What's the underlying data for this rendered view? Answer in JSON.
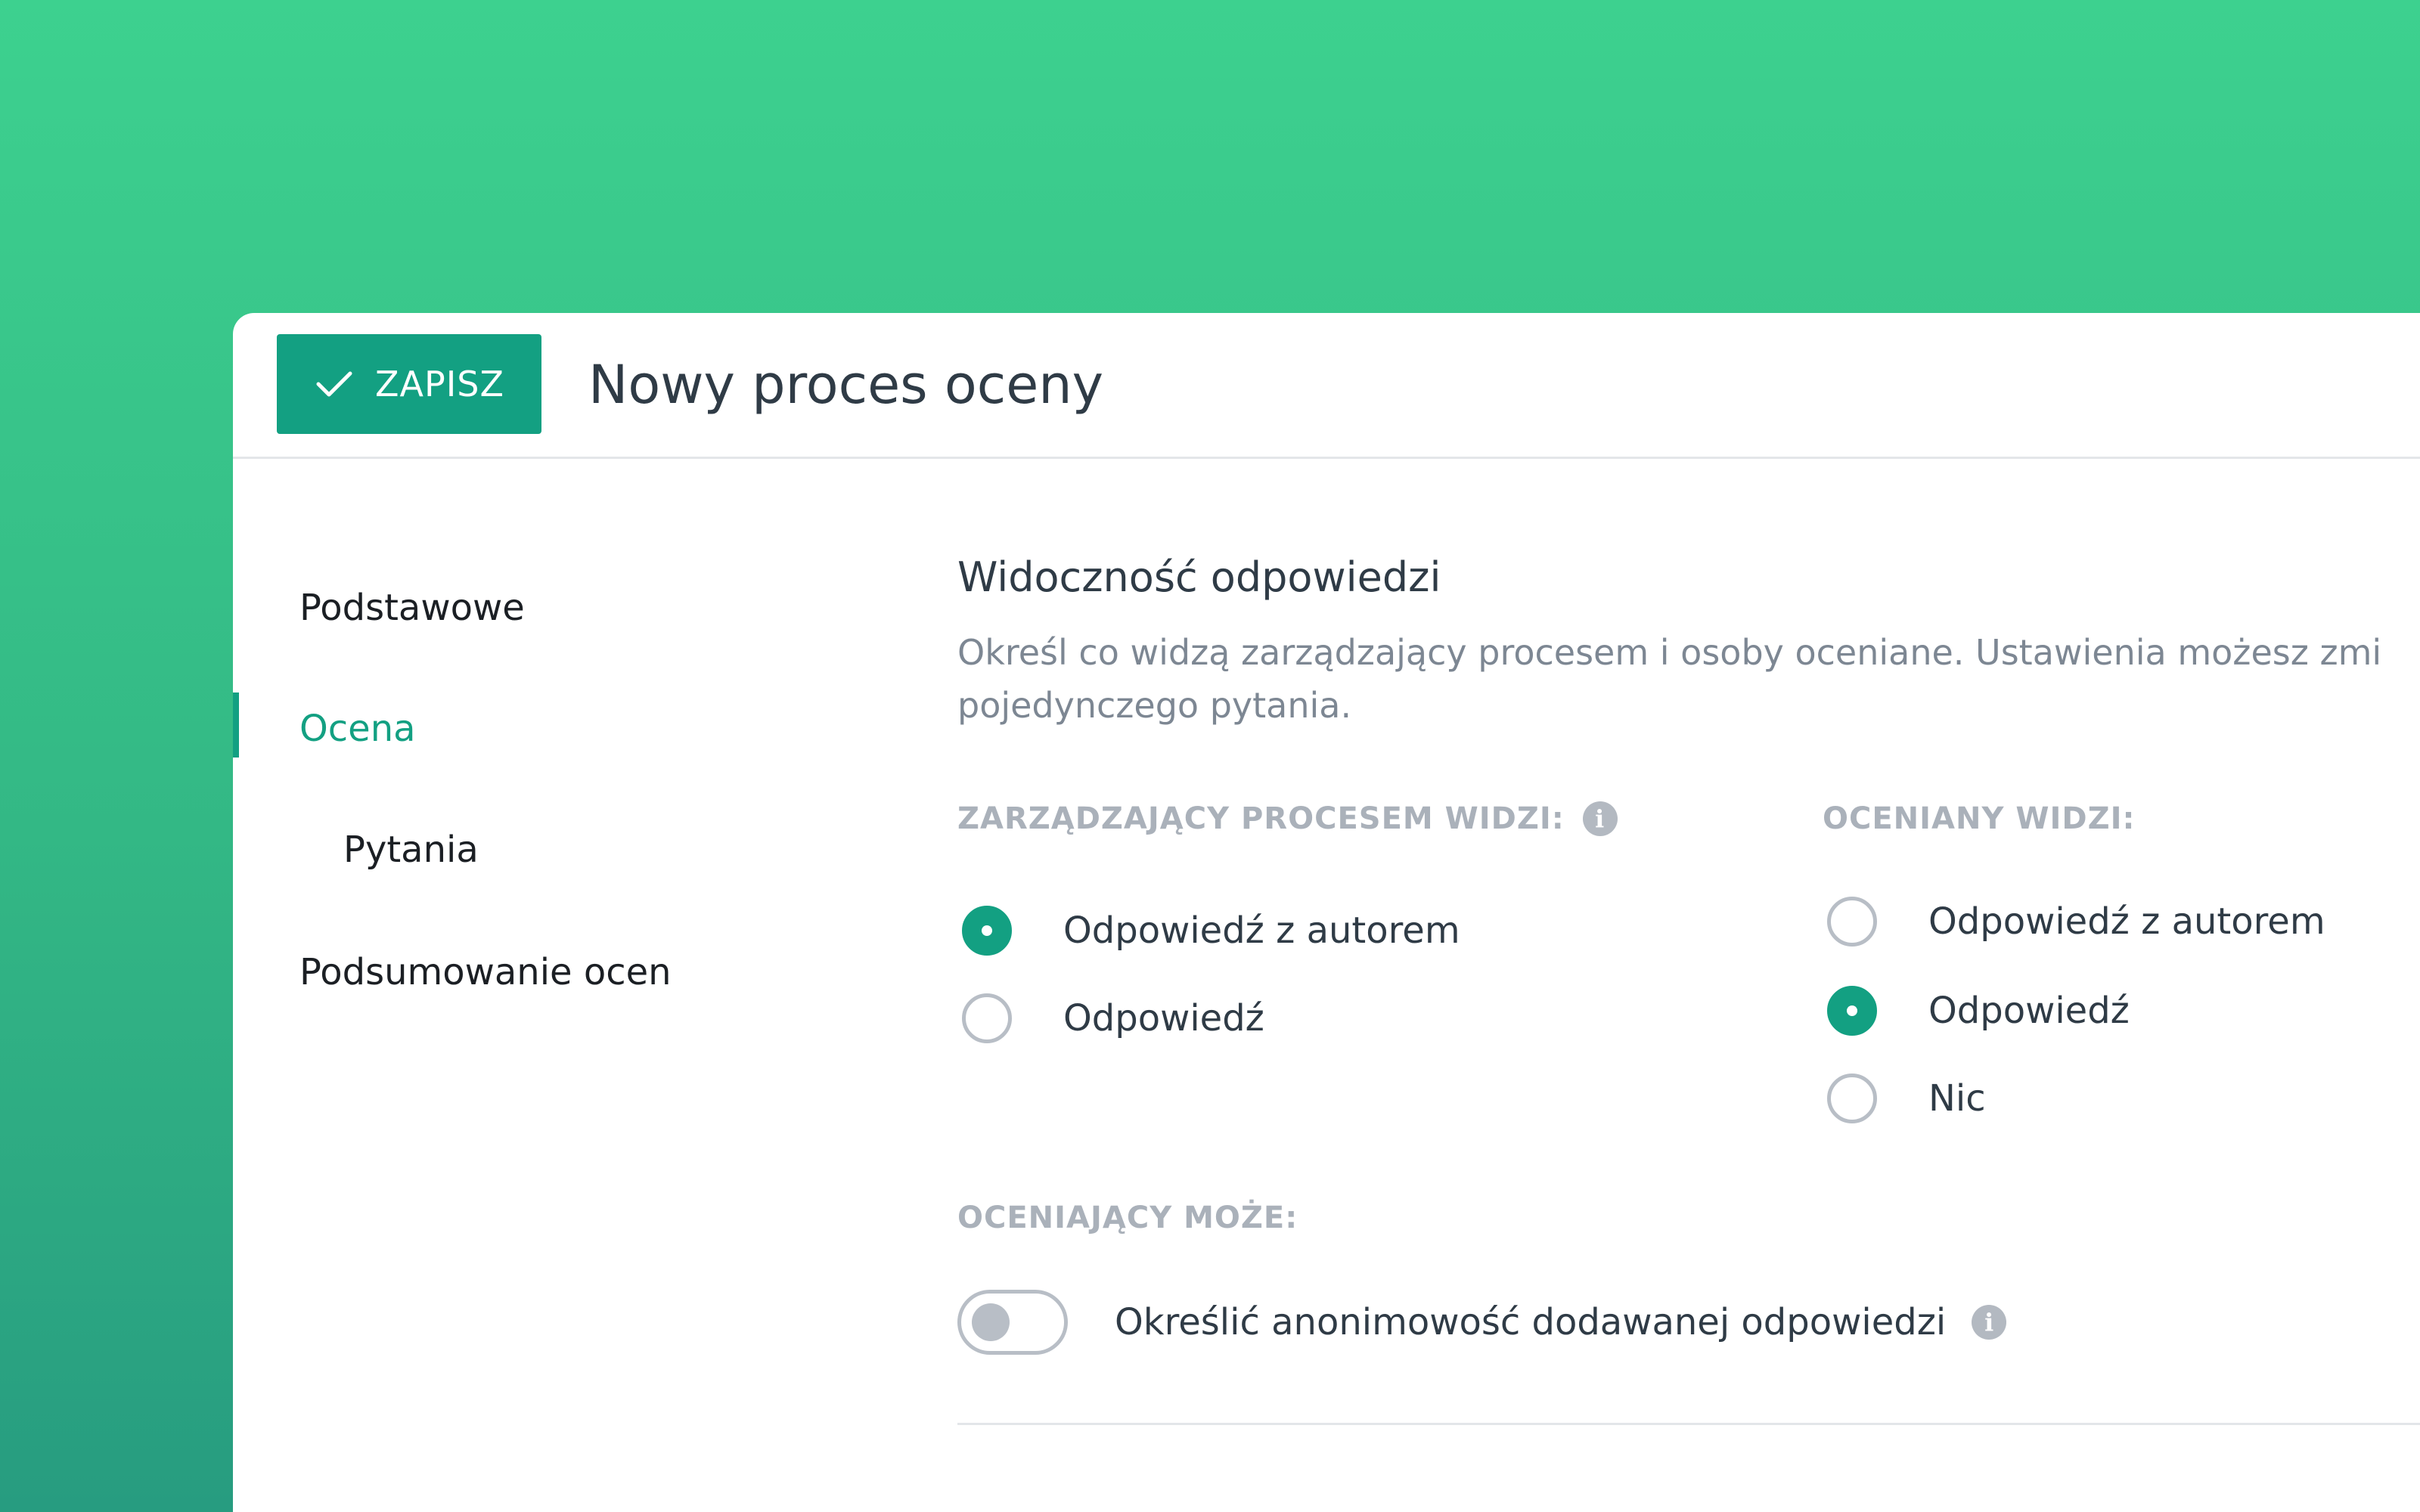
{
  "header": {
    "save_label": "ZAPISZ",
    "title": "Nowy proces oceny"
  },
  "sidebar": {
    "items": [
      {
        "label": "Podstawowe"
      },
      {
        "label": "Ocena",
        "active": true
      },
      {
        "label": "Pytania"
      },
      {
        "label": "Podsumowanie ocen"
      }
    ]
  },
  "section": {
    "title": "Widoczność odpowiedzi",
    "description_line1": "Określ co widzą zarządzający procesem i osoby oceniane. Ustawienia możesz zmi",
    "description_line2": "pojedynczego pytania."
  },
  "manager_group": {
    "label": "ZARZĄDZAJĄCY PROCESEM WIDZI:",
    "options": [
      {
        "label": "Odpowiedź z autorem",
        "checked": true
      },
      {
        "label": "Odpowiedź",
        "checked": false
      }
    ]
  },
  "evaluated_group": {
    "label": "OCENIANY WIDZI:",
    "options": [
      {
        "label": "Odpowiedź z autorem",
        "checked": false
      },
      {
        "label": "Odpowiedź",
        "checked": true
      },
      {
        "label": "Nic",
        "checked": false
      }
    ]
  },
  "evaluator_group": {
    "label": "OCENIAJĄCY MOŻE:",
    "toggle_label": "Określić anonimowość dodawanej odpowiedzi",
    "toggle_on": false
  },
  "colors": {
    "accent": "#13a082",
    "background_top": "#3dd18f",
    "background_bottom": "#279c80"
  }
}
